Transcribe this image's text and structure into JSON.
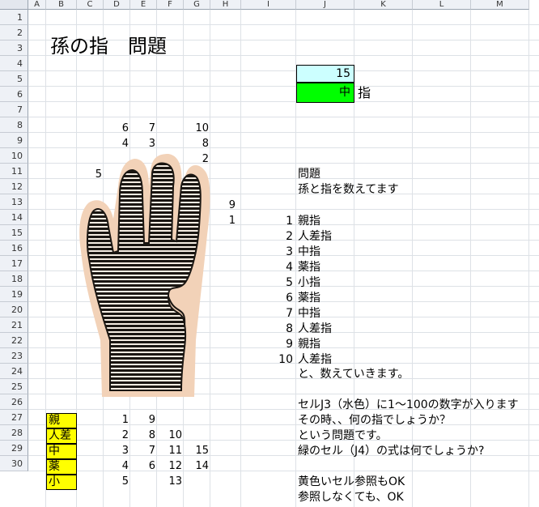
{
  "columns": [
    "A",
    "B",
    "C",
    "D",
    "E",
    "F",
    "G",
    "H",
    "I",
    "J",
    "K",
    "L",
    "M"
  ],
  "rows": [
    "1",
    "2",
    "3",
    "4",
    "5",
    "6",
    "7",
    "8",
    "9",
    "10",
    "11",
    "12",
    "13",
    "14",
    "15",
    "16",
    "17",
    "18",
    "19",
    "20",
    "21",
    "22",
    "23",
    "24",
    "25",
    "26",
    "27",
    "28",
    "29",
    "30"
  ],
  "title": "孫の指　問題",
  "j3_value": "15",
  "j4_value": "中",
  "k4_label": "指",
  "numbers": {
    "d6": "6",
    "e6": "7",
    "g6": "10",
    "d7": "4",
    "e7": "3",
    "g7": "8",
    "g8": "2",
    "c9": "5",
    "h11": "9",
    "h12": "1"
  },
  "problem": {
    "heading": "問題",
    "intro": "孫と指を数えてます",
    "count_list": [
      {
        "n": "1",
        "finger": "親指"
      },
      {
        "n": "2",
        "finger": "人差指"
      },
      {
        "n": "3",
        "finger": "中指"
      },
      {
        "n": "4",
        "finger": "薬指"
      },
      {
        "n": "5",
        "finger": "小指"
      },
      {
        "n": "6",
        "finger": "薬指"
      },
      {
        "n": "7",
        "finger": "中指"
      },
      {
        "n": "8",
        "finger": "人差指"
      },
      {
        "n": "9",
        "finger": "親指"
      },
      {
        "n": "10",
        "finger": "人差指"
      }
    ],
    "continue_text": "と、数えていきます。",
    "line24": "セルJ3（水色）に1～100の数字が入ります",
    "line25": "その時、、何の指でしょうか？",
    "line26": "という問題です。",
    "line27": "緑のセル（J4）の式は何でしょうか?",
    "line29": "黄色いセル参照もOK",
    "line30": "参照しなくても、OK"
  },
  "table": [
    {
      "label": "親",
      "values": [
        "1",
        "9",
        "",
        ""
      ]
    },
    {
      "label": "人差",
      "values": [
        "2",
        "8",
        "10",
        ""
      ]
    },
    {
      "label": "中",
      "values": [
        "3",
        "7",
        "11",
        "15"
      ]
    },
    {
      "label": "薬",
      "values": [
        "4",
        "6",
        "12",
        "14"
      ]
    },
    {
      "label": "小",
      "values": [
        "5",
        "",
        "13",
        ""
      ]
    }
  ],
  "colors": {
    "input_cell": "#ccffff",
    "result_cell": "#00ff00",
    "label_cell": "#ffff00",
    "hand_bg": "#f2d2b8"
  },
  "icons": {
    "hand": "hand-illustration"
  }
}
